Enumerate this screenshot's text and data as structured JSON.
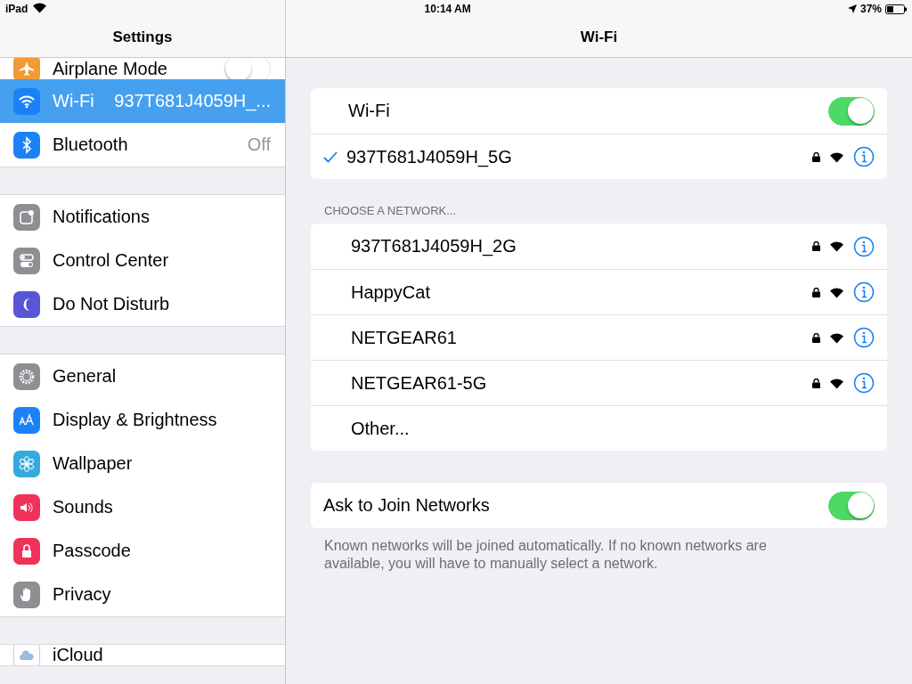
{
  "status_bar": {
    "device": "iPad",
    "time": "10:14 AM",
    "battery": "37%"
  },
  "sidebar": {
    "title": "Settings",
    "groups": [
      [
        {
          "label": "Airplane Mode",
          "color": "#f19a37",
          "kind": "toggle",
          "on": false,
          "selected": false
        },
        {
          "label": "Wi-Fi",
          "value": "937T681J4059H_...",
          "color": "#1a82f6",
          "kind": "value",
          "selected": true
        },
        {
          "label": "Bluetooth",
          "value": "Off",
          "color": "#1a82f6",
          "kind": "value",
          "selected": false
        }
      ],
      [
        {
          "label": "Notifications",
          "color": "#8e8e93",
          "kind": "plain",
          "selected": false
        },
        {
          "label": "Control Center",
          "color": "#8e8e93",
          "kind": "plain",
          "selected": false
        },
        {
          "label": "Do Not Disturb",
          "color": "#5856d6",
          "kind": "plain",
          "selected": false
        }
      ],
      [
        {
          "label": "General",
          "color": "#8e8e93",
          "kind": "plain",
          "selected": false
        },
        {
          "label": "Display & Brightness",
          "color": "#1a82f6",
          "kind": "plain",
          "selected": false
        },
        {
          "label": "Wallpaper",
          "color": "#35aadc",
          "kind": "plain",
          "selected": false
        },
        {
          "label": "Sounds",
          "color": "#f0325a",
          "kind": "plain",
          "selected": false
        },
        {
          "label": "Passcode",
          "color": "#f0325a",
          "kind": "plain",
          "selected": false
        },
        {
          "label": "Privacy",
          "color": "#8e8e93",
          "kind": "plain",
          "selected": false
        }
      ],
      [
        {
          "label": "iCloud",
          "color": "#ffffff",
          "kind": "plain",
          "selected": false
        }
      ]
    ]
  },
  "detail": {
    "title": "Wi-Fi",
    "wifi": {
      "label": "Wi-Fi",
      "on": true
    },
    "current": {
      "name": "937T681J4059H_5G",
      "checked": true,
      "locked": true
    },
    "section_header": "CHOOSE A NETWORK...",
    "networks": [
      {
        "name": "937T681J4059H_2G",
        "locked": true,
        "kind": "network"
      },
      {
        "name": "HappyCat",
        "locked": true,
        "kind": "network"
      },
      {
        "name": "NETGEAR61",
        "locked": true,
        "kind": "network"
      },
      {
        "name": "NETGEAR61-5G",
        "locked": true,
        "kind": "network"
      },
      {
        "name": "Other...",
        "locked": false,
        "kind": "other"
      }
    ],
    "ask": {
      "label": "Ask to Join Networks",
      "on": true
    },
    "footer": "Known networks will be joined automatically. If no known networks are available, you will have to manually select a network."
  }
}
